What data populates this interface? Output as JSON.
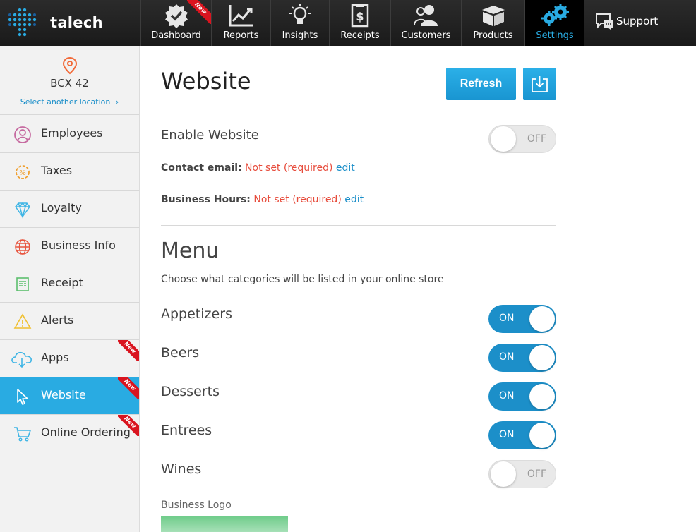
{
  "brand": {
    "name": "talech"
  },
  "nav": {
    "items": [
      {
        "label": "Dashboard",
        "icon": "dashboard-badge-icon",
        "badge": "New"
      },
      {
        "label": "Reports",
        "icon": "chart-line-icon"
      },
      {
        "label": "Insights",
        "icon": "lightbulb-icon"
      },
      {
        "label": "Receipts",
        "icon": "receipt-icon"
      },
      {
        "label": "Customers",
        "icon": "users-icon"
      },
      {
        "label": "Products",
        "icon": "box-icon"
      },
      {
        "label": "Settings",
        "icon": "gears-icon",
        "active": true
      }
    ],
    "support_label": "Support"
  },
  "sidebar": {
    "location_name": "BCX 42",
    "select_location": "Select another location",
    "items": [
      {
        "label": "Employees",
        "icon": "user-circle-icon"
      },
      {
        "label": "Taxes",
        "icon": "tax-gear-icon"
      },
      {
        "label": "Loyalty",
        "icon": "diamond-icon"
      },
      {
        "label": "Business Info",
        "icon": "globe-icon"
      },
      {
        "label": "Receipt",
        "icon": "receipt-doc-icon"
      },
      {
        "label": "Alerts",
        "icon": "warning-icon"
      },
      {
        "label": "Apps",
        "icon": "cloud-download-icon",
        "badge": "New"
      },
      {
        "label": "Website",
        "icon": "cursor-icon",
        "badge": "New",
        "active": true
      },
      {
        "label": "Online Ordering",
        "icon": "cart-icon",
        "badge": "New"
      }
    ]
  },
  "main": {
    "title": "Website",
    "refresh_label": "Refresh",
    "enable_website": {
      "label": "Enable Website",
      "state": "OFF"
    },
    "contact_email": {
      "key": "Contact email:",
      "value": "Not set (required)",
      "edit": "edit"
    },
    "business_hours": {
      "key": "Business Hours:",
      "value": "Not set (required)",
      "edit": "edit"
    },
    "menu": {
      "title": "Menu",
      "subtitle": "Choose what categories will be listed in your online store",
      "categories": [
        {
          "label": "Appetizers",
          "state": "ON"
        },
        {
          "label": "Beers",
          "state": "ON"
        },
        {
          "label": "Desserts",
          "state": "ON"
        },
        {
          "label": "Entrees",
          "state": "ON"
        },
        {
          "label": "Wines",
          "state": "OFF"
        }
      ]
    },
    "business_logo_label": "Business Logo"
  },
  "colors": {
    "accent": "#29abe2",
    "toggle_on": "#1c8fc9",
    "required": "#e74c3c",
    "ribbon": "#d9141f",
    "upload": "#22b14c"
  }
}
